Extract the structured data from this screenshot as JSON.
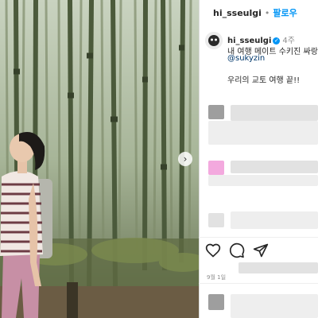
{
  "header": {
    "username": "hi_sseulgi",
    "separator": "•",
    "follow_label": "팔로우"
  },
  "caption": {
    "username": "hi_sseulgi",
    "time": "4주",
    "line1": "내 여행 메이트 수키진 싸랑",
    "mention": "@sukyzin",
    "line2": "우리의 교토 여행 끝!!"
  },
  "post": {
    "date": "9월 1일"
  },
  "icons": {
    "next": "chevron-right-icon",
    "like": "heart-icon",
    "comment": "comment-icon",
    "share": "share-icon",
    "verified": "verified-badge-icon"
  },
  "colors": {
    "accent": "#0095f6",
    "mention": "#00376b",
    "text": "#262626",
    "muted": "#8e8e8e"
  }
}
